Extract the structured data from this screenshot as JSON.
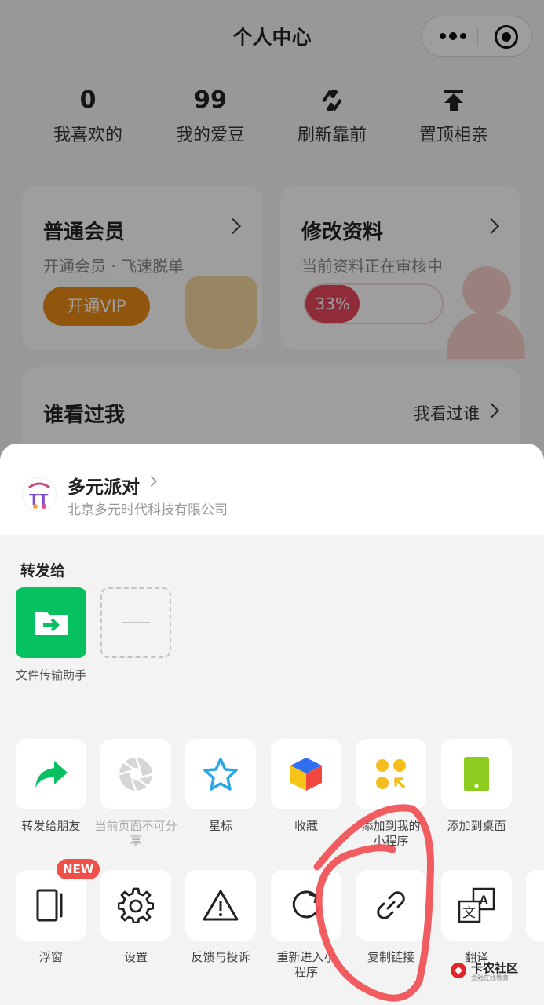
{
  "page": {
    "title": "个人中心",
    "stats": [
      {
        "value": "0",
        "label": "我喜欢的"
      },
      {
        "value": "99",
        "label": "我的爱豆"
      },
      {
        "label": "刷新靠前",
        "icon": "refresh-icon"
      },
      {
        "label": "置顶相亲",
        "icon": "pin-top-icon"
      }
    ],
    "member_card": {
      "title": "普通会员",
      "subtitle": "开通会员 · 飞速脱单",
      "button": "开通VIP"
    },
    "profile_card": {
      "title": "修改资料",
      "subtitle": "当前资料正在审核中",
      "progress_label": "33%",
      "progress": 0.33
    },
    "visitors_card": {
      "title": "谁看过我",
      "link": "我看过谁"
    }
  },
  "sheet": {
    "app_name": "多元派对",
    "app_company": "北京多元时代科技有限公司",
    "forward_title": "转发给",
    "contacts": [
      {
        "name": "文件传输助手",
        "icon": "file-transfer-icon"
      },
      {
        "name": "",
        "icon": "placeholder-icon"
      }
    ],
    "actions_row1": [
      {
        "label": "转发给朋友",
        "icon": "share-arrow-icon"
      },
      {
        "label": "当前页面不可分享",
        "icon": "shutter-icon",
        "disabled": true
      },
      {
        "label": "星标",
        "icon": "star-icon"
      },
      {
        "label": "收藏",
        "icon": "favorites-cube-icon"
      },
      {
        "label": "添加到我的小程序",
        "icon": "mini-program-add-icon"
      },
      {
        "label": "添加到桌面",
        "icon": "phone-desktop-icon"
      }
    ],
    "actions_row2": [
      {
        "label": "浮窗",
        "icon": "float-window-icon",
        "badge": "NEW"
      },
      {
        "label": "设置",
        "icon": "gear-icon"
      },
      {
        "label": "反馈与投诉",
        "icon": "warning-icon"
      },
      {
        "label": "重新进入小程序",
        "icon": "reload-icon"
      },
      {
        "label": "复制链接",
        "icon": "link-icon"
      },
      {
        "label": "翻译",
        "icon": "translate-icon"
      }
    ]
  },
  "watermark": {
    "title": "卡农社区",
    "subtitle": "金融在线教育"
  },
  "colors": {
    "accent_green": "#07c160",
    "vip_orange": "#e88c17",
    "progress_red": "#e8485c",
    "badge_red": "#f0504a",
    "scribble_red": "#f04b50"
  }
}
